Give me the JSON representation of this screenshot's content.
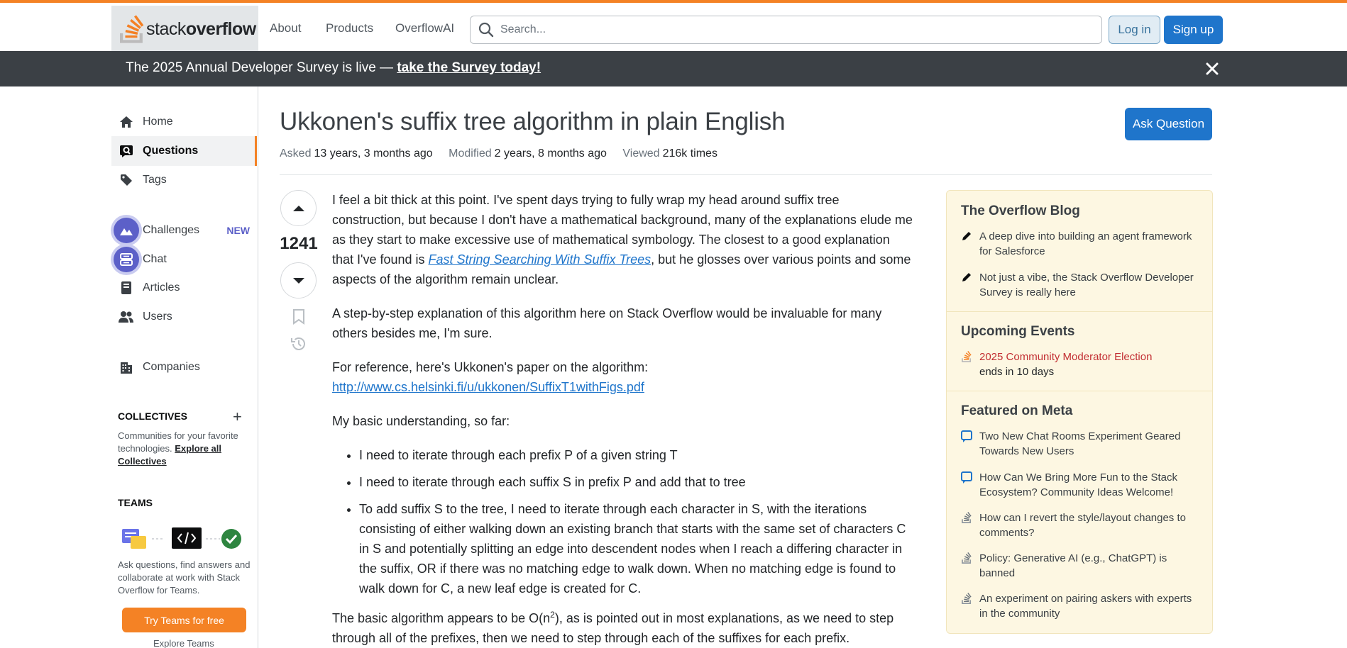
{
  "topbar": {
    "logo_plain": "stack",
    "logo_bold": "overflow",
    "nav": [
      "About",
      "Products",
      "OverflowAI"
    ],
    "search_placeholder": "Search...",
    "login": "Log in",
    "signup": "Sign up"
  },
  "banner": {
    "text": "The 2025 Annual Developer Survey is live — ",
    "link": "take the Survey today!"
  },
  "sidebar": {
    "items": [
      {
        "label": "Home"
      },
      {
        "label": "Questions"
      },
      {
        "label": "Tags"
      },
      {
        "label": "Challenges",
        "badge": "NEW"
      },
      {
        "label": "Chat"
      },
      {
        "label": "Articles"
      },
      {
        "label": "Users"
      },
      {
        "label": "Companies"
      }
    ],
    "collectives_title": "COLLECTIVES",
    "collectives_text": "Communities for your favorite technologies.",
    "collectives_link": "Explore all Collectives",
    "teams_title": "TEAMS",
    "teams_text": "Ask questions, find answers and collaborate at work with Stack Overflow for Teams.",
    "teams_button": "Try Teams for free",
    "teams_explore": "Explore Teams"
  },
  "question": {
    "title": "Ukkonen's suffix tree algorithm in plain English",
    "ask_button": "Ask Question",
    "asked_label": "Asked",
    "asked_value": "13 years, 3 months ago",
    "modified_label": "Modified",
    "modified_value": "2 years, 8 months ago",
    "viewed_label": "Viewed",
    "viewed_value": "216k times",
    "score": "1241",
    "p1_a": "I feel a bit thick at this point. I've spent days trying to fully wrap my head around suffix tree construction, but because I don't have a mathematical background, many of the explanations elude me as they start to make excessive use of mathematical symbology. The closest to a good explanation that I've found is ",
    "p1_link": "Fast String Searching With Suffix Trees",
    "p1_b": ", but he glosses over various points and some aspects of the algorithm remain unclear.",
    "p2": "A step-by-step explanation of this algorithm here on Stack Overflow would be invaluable for many others besides me, I'm sure.",
    "p3": "For reference, here's Ukkonen's paper on the algorithm:",
    "p3_link": "http://www.cs.helsinki.fi/u/ukkonen/SuffixT1withFigs.pdf",
    "p4": "My basic understanding, so far:",
    "bullets": [
      "I need to iterate through each prefix P of a given string T",
      "I need to iterate through each suffix S in prefix P and add that to tree",
      "To add suffix S to the tree, I need to iterate through each character in S, with the iterations consisting of either walking down an existing branch that starts with the same set of characters C in S and potentially splitting an edge into descendent nodes when I reach a differing character in the suffix, OR if there was no matching edge to walk down. When no matching edge is found to walk down for C, a new leaf edge is created for C."
    ],
    "p5_a": "The basic algorithm appears to be O(n",
    "p5_sup": "2",
    "p5_b": "), as is pointed out in most explanations, as we need to step through all of the prefixes, then we need to step through each of the suffixes for each prefix."
  },
  "widget": {
    "blog_title": "The Overflow Blog",
    "blog": [
      "A deep dive into building an agent framework for Salesforce",
      "Not just a vibe, the Stack Overflow Developer Survey is really here"
    ],
    "events_title": "Upcoming Events",
    "event": "2025 Community Moderator Election",
    "event_sub": "ends in 10 days",
    "meta_title": "Featured on Meta",
    "meta": [
      "Two New Chat Rooms Experiment Geared Towards New Users",
      "How Can We Bring More Fun to the Stack Ecosystem? Community Ideas Welcome!",
      "How can I revert the style/layout changes to comments?",
      "Policy: Generative AI (e.g., ChatGPT) is banned",
      "An experiment on pairing askers with experts in the community"
    ]
  },
  "colors": {
    "brand_orange": "#f48225",
    "primary_blue": "#1f75cb",
    "banner_dark": "#3b4045",
    "widget_bg": "#fdf7e2",
    "challenges_purple": "#5c60c8"
  }
}
